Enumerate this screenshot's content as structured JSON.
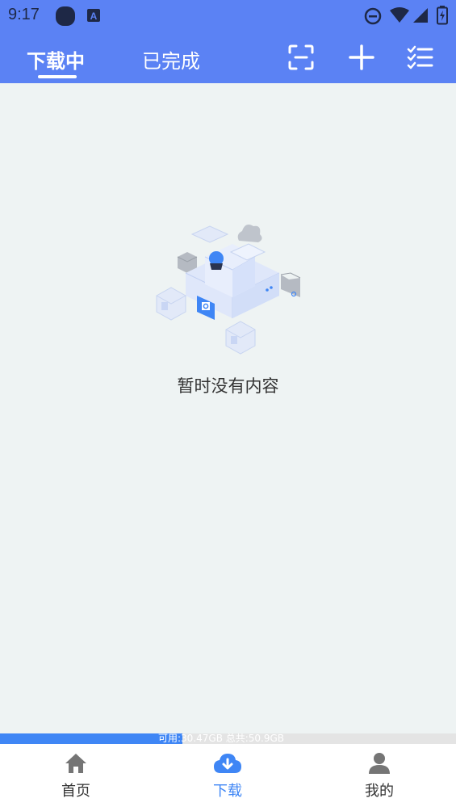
{
  "status_bar": {
    "time": "9:17",
    "icons": [
      "app-dot-icon",
      "a-notification-icon",
      "do-not-disturb-icon",
      "wifi-icon",
      "signal-icon",
      "battery-icon"
    ]
  },
  "header": {
    "tabs": [
      {
        "label": "下载中",
        "active": true
      },
      {
        "label": "已完成",
        "active": false
      }
    ],
    "actions": [
      "scan-icon",
      "add-icon",
      "checklist-icon"
    ]
  },
  "empty_state": {
    "message": "暂时没有内容"
  },
  "storage": {
    "text": "可用:30.47GB 总共:50.9GB",
    "used_fraction": 0.4
  },
  "bottom_nav": {
    "items": [
      {
        "label": "首页",
        "icon": "home-icon",
        "active": false
      },
      {
        "label": "下载",
        "icon": "cloud-download-icon",
        "active": true
      },
      {
        "label": "我的",
        "icon": "profile-icon",
        "active": false
      }
    ]
  },
  "colors": {
    "primary": "#5b82f4",
    "accent": "#3f86f5",
    "background": "#eef3f3"
  }
}
